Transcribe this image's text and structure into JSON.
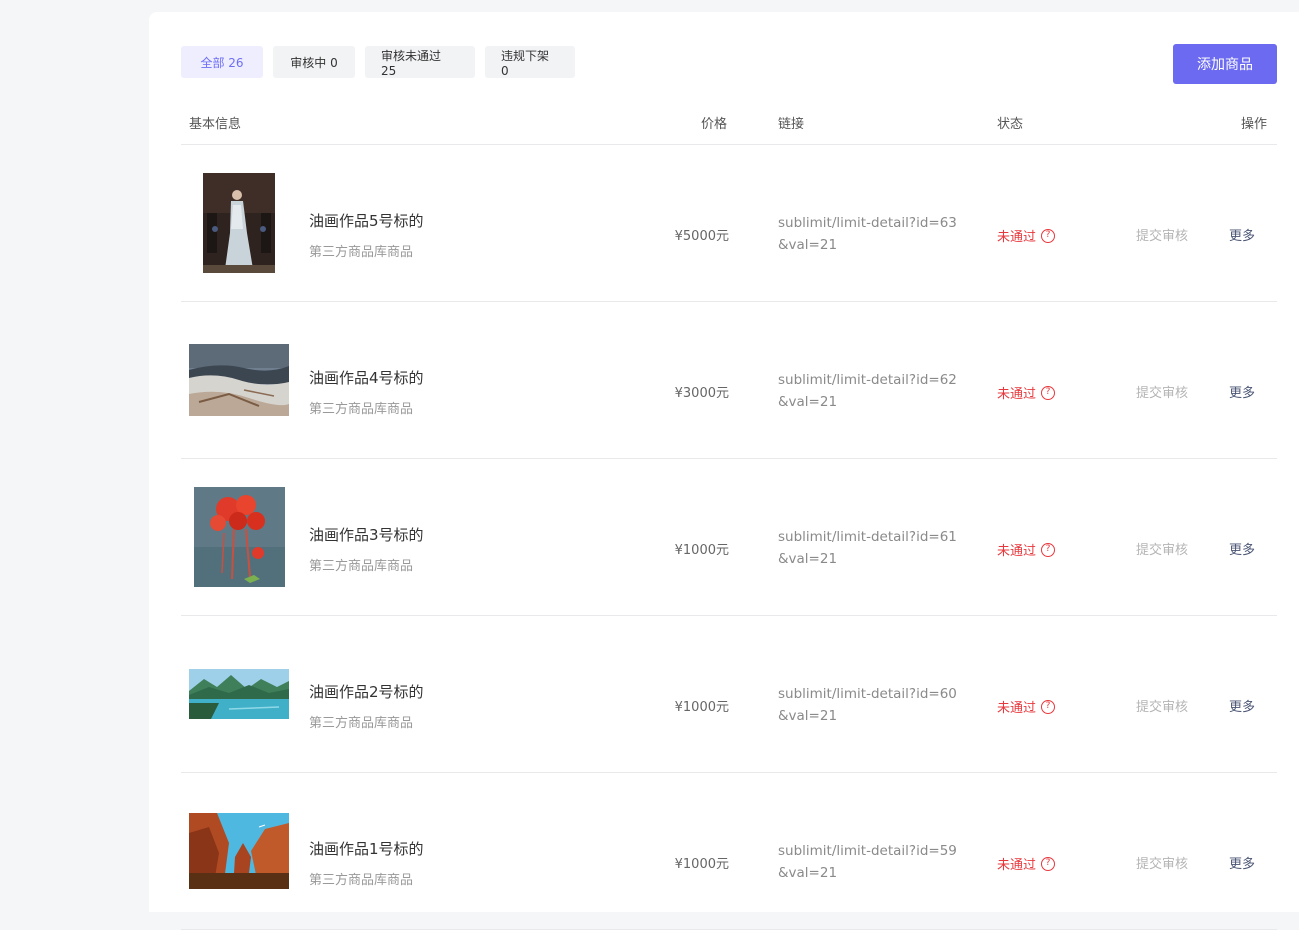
{
  "tabs": [
    {
      "label": "全部 26",
      "active": true
    },
    {
      "label": "审核中 0",
      "active": false
    },
    {
      "label": "审核未通过 25",
      "active": false
    },
    {
      "label": "违规下架 0",
      "active": false
    }
  ],
  "add_button": "添加商品",
  "columns": {
    "info": "基本信息",
    "price": "价格",
    "link": "链接",
    "status": "状态",
    "actions": "操作"
  },
  "products": [
    {
      "name": "油画作品5号标的",
      "source": "第三方商品库商品",
      "price": "¥5000元",
      "link": "sublimit/limit-detail?id=63&val=21",
      "status": "未通过",
      "submit": "提交审核",
      "more": "更多",
      "thumb": "portrait-woman-white-dress-icon"
    },
    {
      "name": "油画作品4号标的",
      "source": "第三方商品库商品",
      "price": "¥3000元",
      "link": "sublimit/limit-detail?id=62&val=21",
      "status": "未通过",
      "submit": "提交审核",
      "more": "更多",
      "thumb": "snow-landscape-icon"
    },
    {
      "name": "油画作品3号标的",
      "source": "第三方商品库商品",
      "price": "¥1000元",
      "link": "sublimit/limit-detail?id=61&val=21",
      "status": "未通过",
      "submit": "提交审核",
      "more": "更多",
      "thumb": "red-flowers-icon"
    },
    {
      "name": "油画作品2号标的",
      "source": "第三方商品库商品",
      "price": "¥1000元",
      "link": "sublimit/limit-detail?id=60&val=21",
      "status": "未通过",
      "submit": "提交审核",
      "more": "更多",
      "thumb": "mountain-lake-icon"
    },
    {
      "name": "油画作品1号标的",
      "source": "第三方商品库商品",
      "price": "¥1000元",
      "link": "sublimit/limit-detail?id=59&val=21",
      "status": "未通过",
      "submit": "提交审核",
      "more": "更多",
      "thumb": "red-canyon-icon"
    }
  ],
  "colors": {
    "accent": "#6b6af0",
    "status_failed": "#e8383d"
  }
}
